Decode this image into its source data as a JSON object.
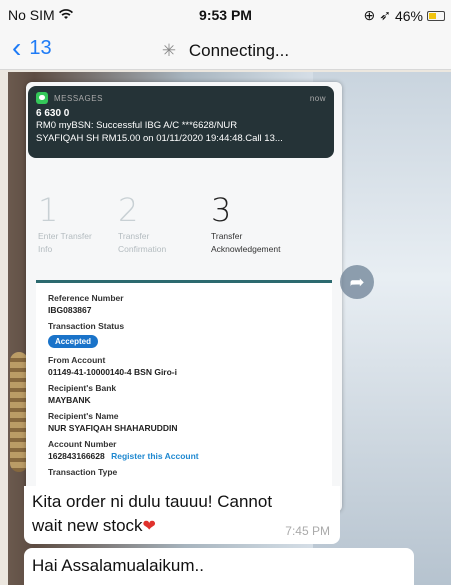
{
  "status_bar": {
    "carrier": "No SIM",
    "time": "9:53 PM",
    "battery": "46%",
    "battery_color": "#f1c40f"
  },
  "chat_header": {
    "back_count": "13",
    "connection_status": "Connecting..."
  },
  "notification": {
    "app": "MESSAGES",
    "time": "now",
    "sender": "6 630 0",
    "line1": "RM0 myBSN: Successful IBG A/C ***6628/NUR",
    "line2": "SYAFIQAH SH RM15.00 on 01/11/2020 19:44:48.Call 13..."
  },
  "steps": [
    {
      "number": "1",
      "label_line1": "Enter Transfer",
      "label_line2": "Info"
    },
    {
      "number": "2",
      "label_line1": "Transfer",
      "label_line2": "Confirmation"
    },
    {
      "number": "3",
      "label_line1": "Transfer",
      "label_line2": "Acknowledgement"
    }
  ],
  "receipt": {
    "reference_label": "Reference Number",
    "reference_value": "IBG083867",
    "status_label": "Transaction Status",
    "status_value": "Accepted",
    "from_label": "From Account",
    "from_value": "01149-41-10000140-4 BSN Giro-i",
    "bank_label": "Recipient's Bank",
    "bank_value": "MAYBANK",
    "name_label": "Recipient's Name",
    "name_value": "NUR SYAFIQAH SHAHARUDDIN",
    "account_label": "Account Number",
    "account_value": "162843166628",
    "register_link": "Register this Account",
    "type_label": "Transaction Type"
  },
  "caption": {
    "line1": "Kita order ni dulu tauuu! Cannot",
    "line2": "wait new stock",
    "time": "7:45 PM"
  },
  "next_message": {
    "text": "Hai Assalamualaikum.."
  },
  "colors": {
    "accent_blue": "#1e7bf6",
    "badge_blue": "#1a73c9",
    "card_teal": "#2c6a6f"
  }
}
